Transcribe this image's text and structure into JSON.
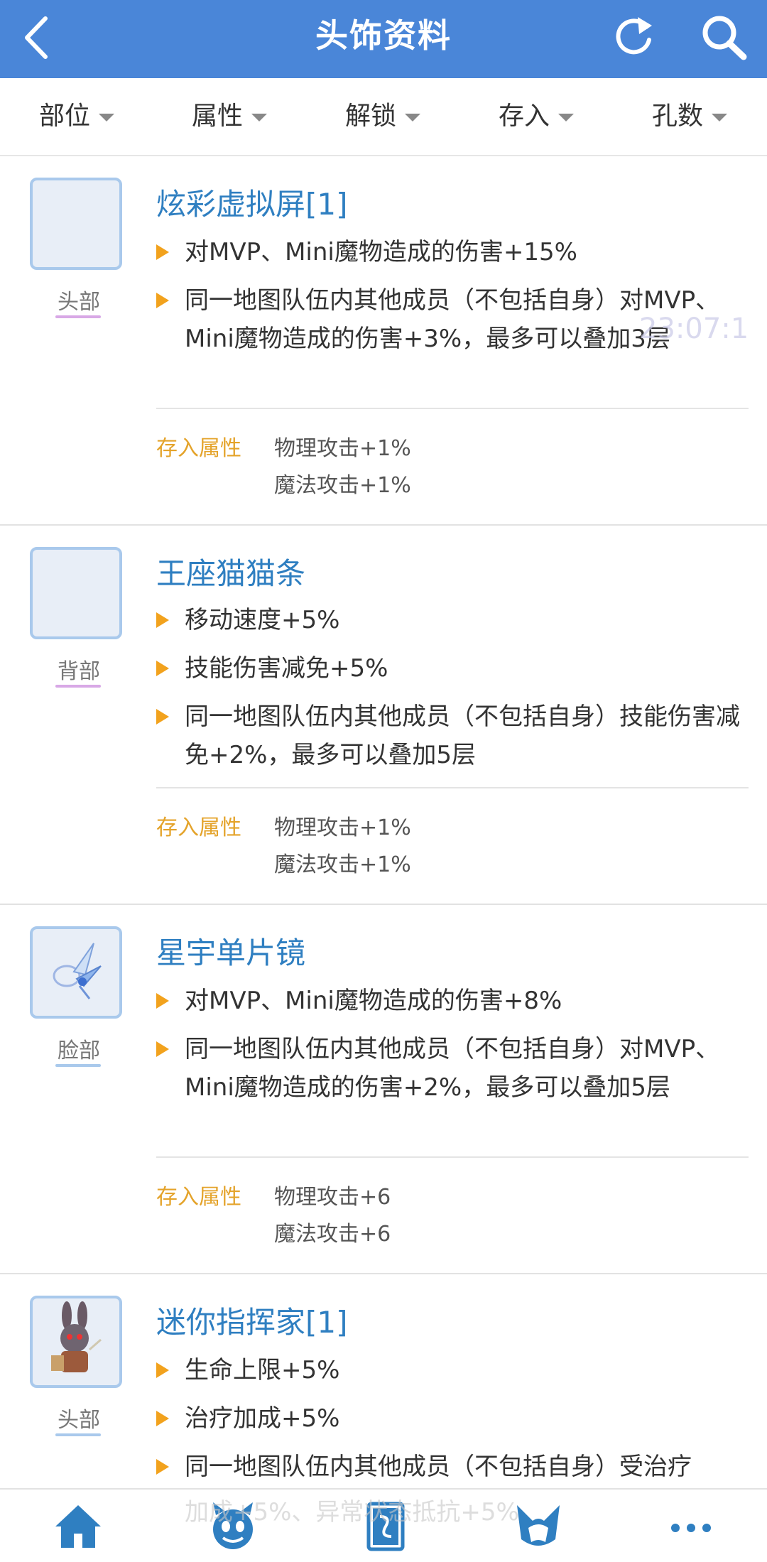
{
  "header": {
    "title": "头饰资料",
    "back_icon": "chevron-left-icon",
    "refresh_icon": "refresh-icon",
    "search_icon": "search-icon"
  },
  "filters": [
    "部位",
    "属性",
    "解锁",
    "存入",
    "孔数"
  ],
  "items": [
    {
      "name": "炫彩虚拟屏[1]",
      "slot": "头部",
      "slot_color": "#d8a8e6",
      "effects": [
        "对MVP、Mini魔物造成的伤害+15%",
        "同一地图队伍内其他成员（不包括自身）对MVP、Mini魔物造成的伤害+3%，最多可以叠加3层"
      ],
      "deposit_label": "存入属性",
      "deposit": [
        "物理攻击+1%",
        "魔法攻击+1%"
      ]
    },
    {
      "name": "王座猫猫条",
      "slot": "背部",
      "slot_color": "#d8a8e6",
      "effects": [
        "移动速度+5%",
        "技能伤害减免+5%",
        "同一地图队伍内其他成员（不包括自身）技能伤害减免+2%，最多可以叠加5层"
      ],
      "deposit_label": "存入属性",
      "deposit": [
        "物理攻击+1%",
        "魔法攻击+1%"
      ]
    },
    {
      "name": "星宇单片镜",
      "slot": "脸部",
      "slot_color": "#a9c9ec",
      "effects": [
        "对MVP、Mini魔物造成的伤害+8%",
        "同一地图队伍内其他成员（不包括自身）对MVP、Mini魔物造成的伤害+2%，最多可以叠加5层"
      ],
      "deposit_label": "存入属性",
      "deposit": [
        "物理攻击+6",
        "魔法攻击+6"
      ]
    },
    {
      "name": "迷你指挥家[1]",
      "slot": "头部",
      "slot_color": "#a9c9ec",
      "effects": [
        "生命上限+5%",
        "治疗加成+5%",
        "同一地图队伍内其他成员（不包括自身）受治疗"
      ],
      "deposit_label": "",
      "deposit": []
    }
  ],
  "watermark": "23:07:1",
  "overlay_partial": "加成+5%、异常状态抵抗+5%",
  "bottom_nav": [
    "home-icon",
    "monster-face-icon",
    "card-icon",
    "cat-ears-icon",
    "more-icon"
  ],
  "colors": {
    "header_bg": "#4a86d8",
    "item_name": "#2f7fc1",
    "deposit_label": "#e4a32a",
    "bullet": "#f2a21d"
  }
}
